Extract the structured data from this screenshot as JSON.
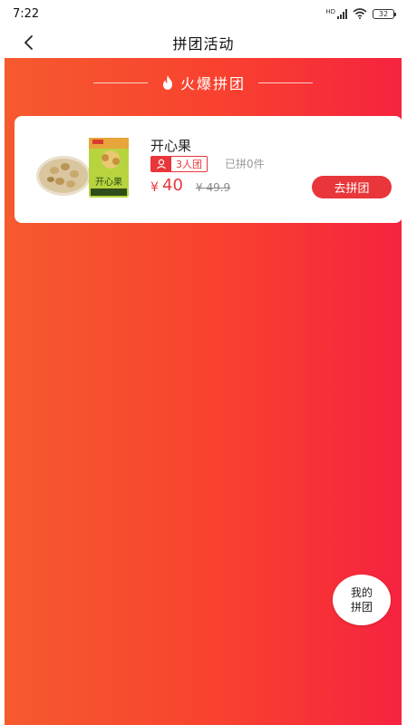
{
  "status_bar": {
    "time": "7:22",
    "network": "HD",
    "battery": "32"
  },
  "nav": {
    "title": "拼团活动"
  },
  "section": {
    "title": "火爆拼团"
  },
  "product": {
    "name": "开心果",
    "image_label": "开心果",
    "group_size": "3人团",
    "joined": "已拼0件",
    "currency": "¥",
    "price": "40",
    "original_price": "¥ 49.9",
    "button_label": "去拼团"
  },
  "floating": {
    "line1": "我的",
    "line2": "拼团"
  },
  "colors": {
    "accent": "#e8363a",
    "gradient_start": "#f65a2f",
    "gradient_end": "#f6233f"
  }
}
